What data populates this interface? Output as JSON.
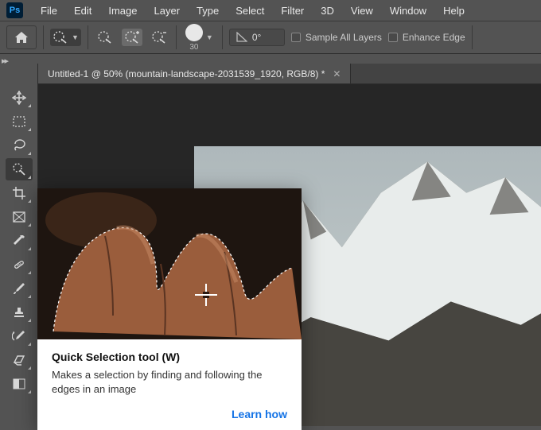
{
  "app": {
    "logo_text": "Ps"
  },
  "menu": [
    "File",
    "Edit",
    "Image",
    "Layer",
    "Type",
    "Select",
    "Filter",
    "3D",
    "View",
    "Window",
    "Help"
  ],
  "options": {
    "brush_size": "30",
    "angle": "0°",
    "sample_all_layers": "Sample All Layers",
    "enhance_edge": "Enhance Edge"
  },
  "tab": {
    "title": "Untitled-1 @ 50% (mountain-landscape-2031539_1920, RGB/8) *"
  },
  "tooltip": {
    "title": "Quick Selection tool (W)",
    "desc": "Makes a selection by finding and following the edges in an image",
    "learn": "Learn how"
  },
  "tools": [
    {
      "name": "move-tool"
    },
    {
      "name": "marquee-tool"
    },
    {
      "name": "lasso-tool"
    },
    {
      "name": "quick-selection-tool",
      "selected": true
    },
    {
      "name": "crop-tool"
    },
    {
      "name": "frame-tool"
    },
    {
      "name": "eyedropper-tool"
    },
    {
      "name": "healing-brush-tool"
    },
    {
      "name": "brush-tool"
    },
    {
      "name": "clone-stamp-tool"
    },
    {
      "name": "history-brush-tool"
    },
    {
      "name": "eraser-tool"
    },
    {
      "name": "gradient-tool"
    }
  ]
}
